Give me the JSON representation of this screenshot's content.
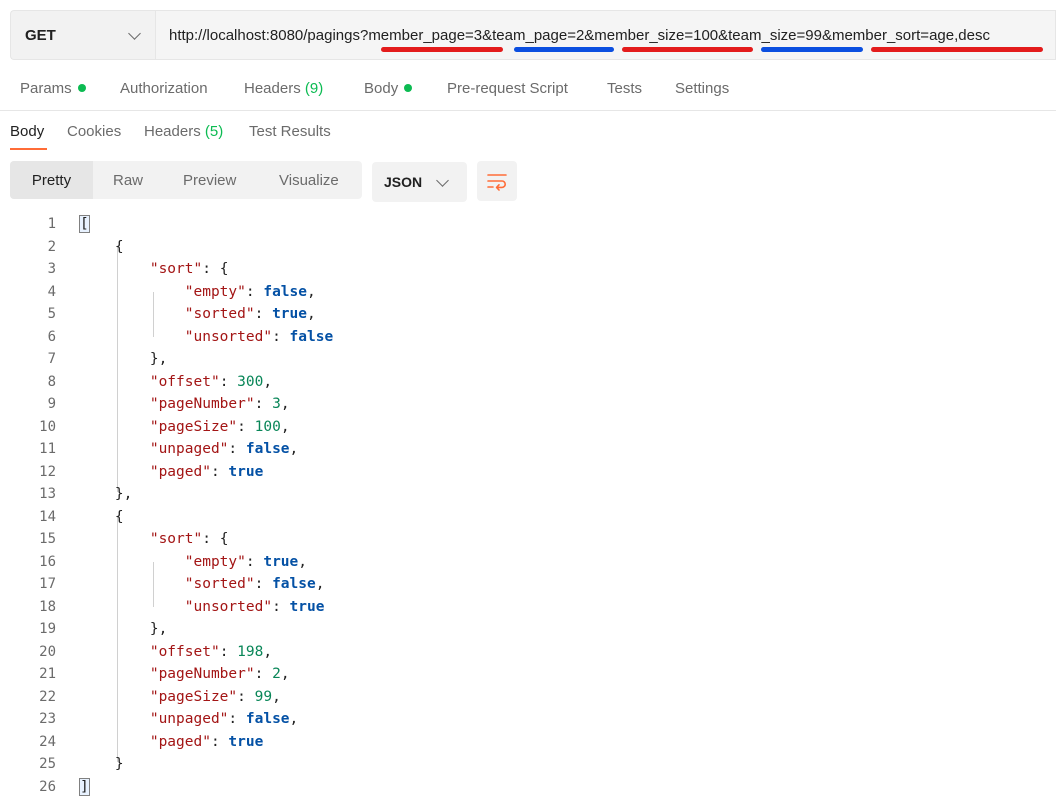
{
  "request": {
    "method": "GET",
    "url": "http://localhost:8080/pagings?member_page=3&team_page=2&member_size=100&team_size=99&member_sort=age,desc"
  },
  "request_tabs": {
    "params": "Params",
    "authorization": "Authorization",
    "headers": "Headers",
    "headers_count": "(9)",
    "body": "Body",
    "prerequest": "Pre-request Script",
    "tests": "Tests",
    "settings": "Settings"
  },
  "response_tabs": {
    "body": "Body",
    "cookies": "Cookies",
    "headers": "Headers",
    "headers_count": "(5)",
    "test_results": "Test Results"
  },
  "view_modes": {
    "pretty": "Pretty",
    "raw": "Raw",
    "preview": "Preview",
    "visualize": "Visualize"
  },
  "format": "JSON",
  "colors": {
    "accent": "#ff6c37",
    "status_dot": "#0cbb52",
    "annotation_red": "#e31b1b",
    "annotation_blue": "#0b4fe0"
  },
  "response_lines": [
    [
      [
        "p",
        "["
      ]
    ],
    [
      [
        "p",
        "    {"
      ]
    ],
    [
      [
        "p",
        "        "
      ],
      [
        "k",
        "\"sort\""
      ],
      [
        "p",
        ": {"
      ]
    ],
    [
      [
        "p",
        "            "
      ],
      [
        "k",
        "\"empty\""
      ],
      [
        "p",
        ": "
      ],
      [
        "b",
        "false"
      ],
      [
        "p",
        ","
      ]
    ],
    [
      [
        "p",
        "            "
      ],
      [
        "k",
        "\"sorted\""
      ],
      [
        "p",
        ": "
      ],
      [
        "b",
        "true"
      ],
      [
        "p",
        ","
      ]
    ],
    [
      [
        "p",
        "            "
      ],
      [
        "k",
        "\"unsorted\""
      ],
      [
        "p",
        ": "
      ],
      [
        "b",
        "false"
      ]
    ],
    [
      [
        "p",
        "        },"
      ]
    ],
    [
      [
        "p",
        "        "
      ],
      [
        "k",
        "\"offset\""
      ],
      [
        "p",
        ": "
      ],
      [
        "n",
        "300"
      ],
      [
        "p",
        ","
      ]
    ],
    [
      [
        "p",
        "        "
      ],
      [
        "k",
        "\"pageNumber\""
      ],
      [
        "p",
        ": "
      ],
      [
        "n",
        "3"
      ],
      [
        "p",
        ","
      ]
    ],
    [
      [
        "p",
        "        "
      ],
      [
        "k",
        "\"pageSize\""
      ],
      [
        "p",
        ": "
      ],
      [
        "n",
        "100"
      ],
      [
        "p",
        ","
      ]
    ],
    [
      [
        "p",
        "        "
      ],
      [
        "k",
        "\"unpaged\""
      ],
      [
        "p",
        ": "
      ],
      [
        "b",
        "false"
      ],
      [
        "p",
        ","
      ]
    ],
    [
      [
        "p",
        "        "
      ],
      [
        "k",
        "\"paged\""
      ],
      [
        "p",
        ": "
      ],
      [
        "b",
        "true"
      ]
    ],
    [
      [
        "p",
        "    },"
      ]
    ],
    [
      [
        "p",
        "    {"
      ]
    ],
    [
      [
        "p",
        "        "
      ],
      [
        "k",
        "\"sort\""
      ],
      [
        "p",
        ": {"
      ]
    ],
    [
      [
        "p",
        "            "
      ],
      [
        "k",
        "\"empty\""
      ],
      [
        "p",
        ": "
      ],
      [
        "b",
        "true"
      ],
      [
        "p",
        ","
      ]
    ],
    [
      [
        "p",
        "            "
      ],
      [
        "k",
        "\"sorted\""
      ],
      [
        "p",
        ": "
      ],
      [
        "b",
        "false"
      ],
      [
        "p",
        ","
      ]
    ],
    [
      [
        "p",
        "            "
      ],
      [
        "k",
        "\"unsorted\""
      ],
      [
        "p",
        ": "
      ],
      [
        "b",
        "true"
      ]
    ],
    [
      [
        "p",
        "        },"
      ]
    ],
    [
      [
        "p",
        "        "
      ],
      [
        "k",
        "\"offset\""
      ],
      [
        "p",
        ": "
      ],
      [
        "n",
        "198"
      ],
      [
        "p",
        ","
      ]
    ],
    [
      [
        "p",
        "        "
      ],
      [
        "k",
        "\"pageNumber\""
      ],
      [
        "p",
        ": "
      ],
      [
        "n",
        "2"
      ],
      [
        "p",
        ","
      ]
    ],
    [
      [
        "p",
        "        "
      ],
      [
        "k",
        "\"pageSize\""
      ],
      [
        "p",
        ": "
      ],
      [
        "n",
        "99"
      ],
      [
        "p",
        ","
      ]
    ],
    [
      [
        "p",
        "        "
      ],
      [
        "k",
        "\"unpaged\""
      ],
      [
        "p",
        ": "
      ],
      [
        "b",
        "false"
      ],
      [
        "p",
        ","
      ]
    ],
    [
      [
        "p",
        "        "
      ],
      [
        "k",
        "\"paged\""
      ],
      [
        "p",
        ": "
      ],
      [
        "b",
        "true"
      ]
    ],
    [
      [
        "p",
        "    }"
      ]
    ],
    [
      [
        "p",
        "]"
      ]
    ]
  ]
}
